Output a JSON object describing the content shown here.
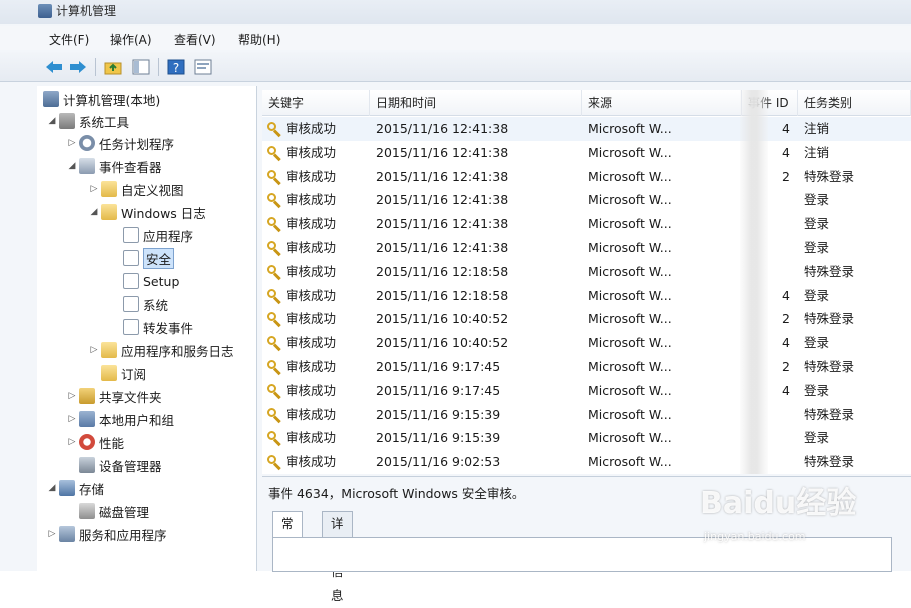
{
  "window": {
    "title": "计算机管理"
  },
  "menu": [
    "文件(F)",
    "操作(A)",
    "查看(V)",
    "帮助(H)"
  ],
  "toolbar": {
    "buttons": [
      "back-icon",
      "forward-icon",
      "up-folder-icon",
      "show-hide-tree-icon",
      "help-icon",
      "properties-icon"
    ]
  },
  "tree": [
    {
      "label": "计算机管理(本地)",
      "icon": "computer-icon"
    },
    {
      "label": "系统工具",
      "icon": "tools-icon"
    },
    {
      "label": "任务计划程序",
      "icon": "clock-icon"
    },
    {
      "label": "事件查看器",
      "icon": "event-viewer-icon"
    },
    {
      "label": "自定义视图",
      "icon": "folder-icon"
    },
    {
      "label": "Windows 日志",
      "icon": "folder-icon"
    },
    {
      "label": "应用程序",
      "icon": "log-icon"
    },
    {
      "label": "安全",
      "icon": "log-icon"
    },
    {
      "label": "Setup",
      "icon": "log-icon"
    },
    {
      "label": "系统",
      "icon": "log-icon"
    },
    {
      "label": "转发事件",
      "icon": "log-icon"
    },
    {
      "label": "应用程序和服务日志",
      "icon": "folder-icon"
    },
    {
      "label": "订阅",
      "icon": "subscription-icon"
    },
    {
      "label": "共享文件夹",
      "icon": "shared-folder-icon"
    },
    {
      "label": "本地用户和组",
      "icon": "users-icon"
    },
    {
      "label": "性能",
      "icon": "performance-icon"
    },
    {
      "label": "设备管理器",
      "icon": "device-manager-icon"
    },
    {
      "label": "存储",
      "icon": "storage-icon"
    },
    {
      "label": "磁盘管理",
      "icon": "disk-icon"
    },
    {
      "label": "服务和应用程序",
      "icon": "services-icon"
    }
  ],
  "list": {
    "columns": [
      "关键字",
      "日期和时间",
      "来源",
      "事件 ID",
      "任务类别"
    ],
    "rows": [
      {
        "keyword": "审核成功",
        "datetime": "2015/11/16 12:41:38",
        "source": "Microsoft W...",
        "id": "4",
        "category": "注销"
      },
      {
        "keyword": "审核成功",
        "datetime": "2015/11/16 12:41:38",
        "source": "Microsoft W...",
        "id": "4",
        "category": "注销"
      },
      {
        "keyword": "审核成功",
        "datetime": "2015/11/16 12:41:38",
        "source": "Microsoft W...",
        "id": "2",
        "category": "特殊登录"
      },
      {
        "keyword": "审核成功",
        "datetime": "2015/11/16 12:41:38",
        "source": "Microsoft W...",
        "id": "",
        "category": "登录"
      },
      {
        "keyword": "审核成功",
        "datetime": "2015/11/16 12:41:38",
        "source": "Microsoft W...",
        "id": "",
        "category": "登录"
      },
      {
        "keyword": "审核成功",
        "datetime": "2015/11/16 12:41:38",
        "source": "Microsoft W...",
        "id": "",
        "category": "登录"
      },
      {
        "keyword": "审核成功",
        "datetime": "2015/11/16 12:18:58",
        "source": "Microsoft W...",
        "id": "",
        "category": "特殊登录"
      },
      {
        "keyword": "审核成功",
        "datetime": "2015/11/16 12:18:58",
        "source": "Microsoft W...",
        "id": "4",
        "category": "登录"
      },
      {
        "keyword": "审核成功",
        "datetime": "2015/11/16 10:40:52",
        "source": "Microsoft W...",
        "id": "2",
        "category": "特殊登录"
      },
      {
        "keyword": "审核成功",
        "datetime": "2015/11/16 10:40:52",
        "source": "Microsoft W...",
        "id": "4",
        "category": "登录"
      },
      {
        "keyword": "审核成功",
        "datetime": "2015/11/16 9:17:45",
        "source": "Microsoft W...",
        "id": "2",
        "category": "特殊登录"
      },
      {
        "keyword": "审核成功",
        "datetime": "2015/11/16 9:17:45",
        "source": "Microsoft W...",
        "id": "4",
        "category": "登录"
      },
      {
        "keyword": "审核成功",
        "datetime": "2015/11/16 9:15:39",
        "source": "Microsoft W...",
        "id": "",
        "category": "特殊登录"
      },
      {
        "keyword": "审核成功",
        "datetime": "2015/11/16 9:15:39",
        "source": "Microsoft W...",
        "id": "",
        "category": "登录"
      },
      {
        "keyword": "审核成功",
        "datetime": "2015/11/16 9:02:53",
        "source": "Microsoft W...",
        "id": "",
        "category": "特殊登录"
      }
    ]
  },
  "detail": {
    "title": "事件 4634，Microsoft Windows 安全审核。",
    "tabs": [
      "常规",
      "详细信息"
    ]
  },
  "watermark": {
    "main": "Baidu经验",
    "sub": "jingyan.baidu.com"
  }
}
